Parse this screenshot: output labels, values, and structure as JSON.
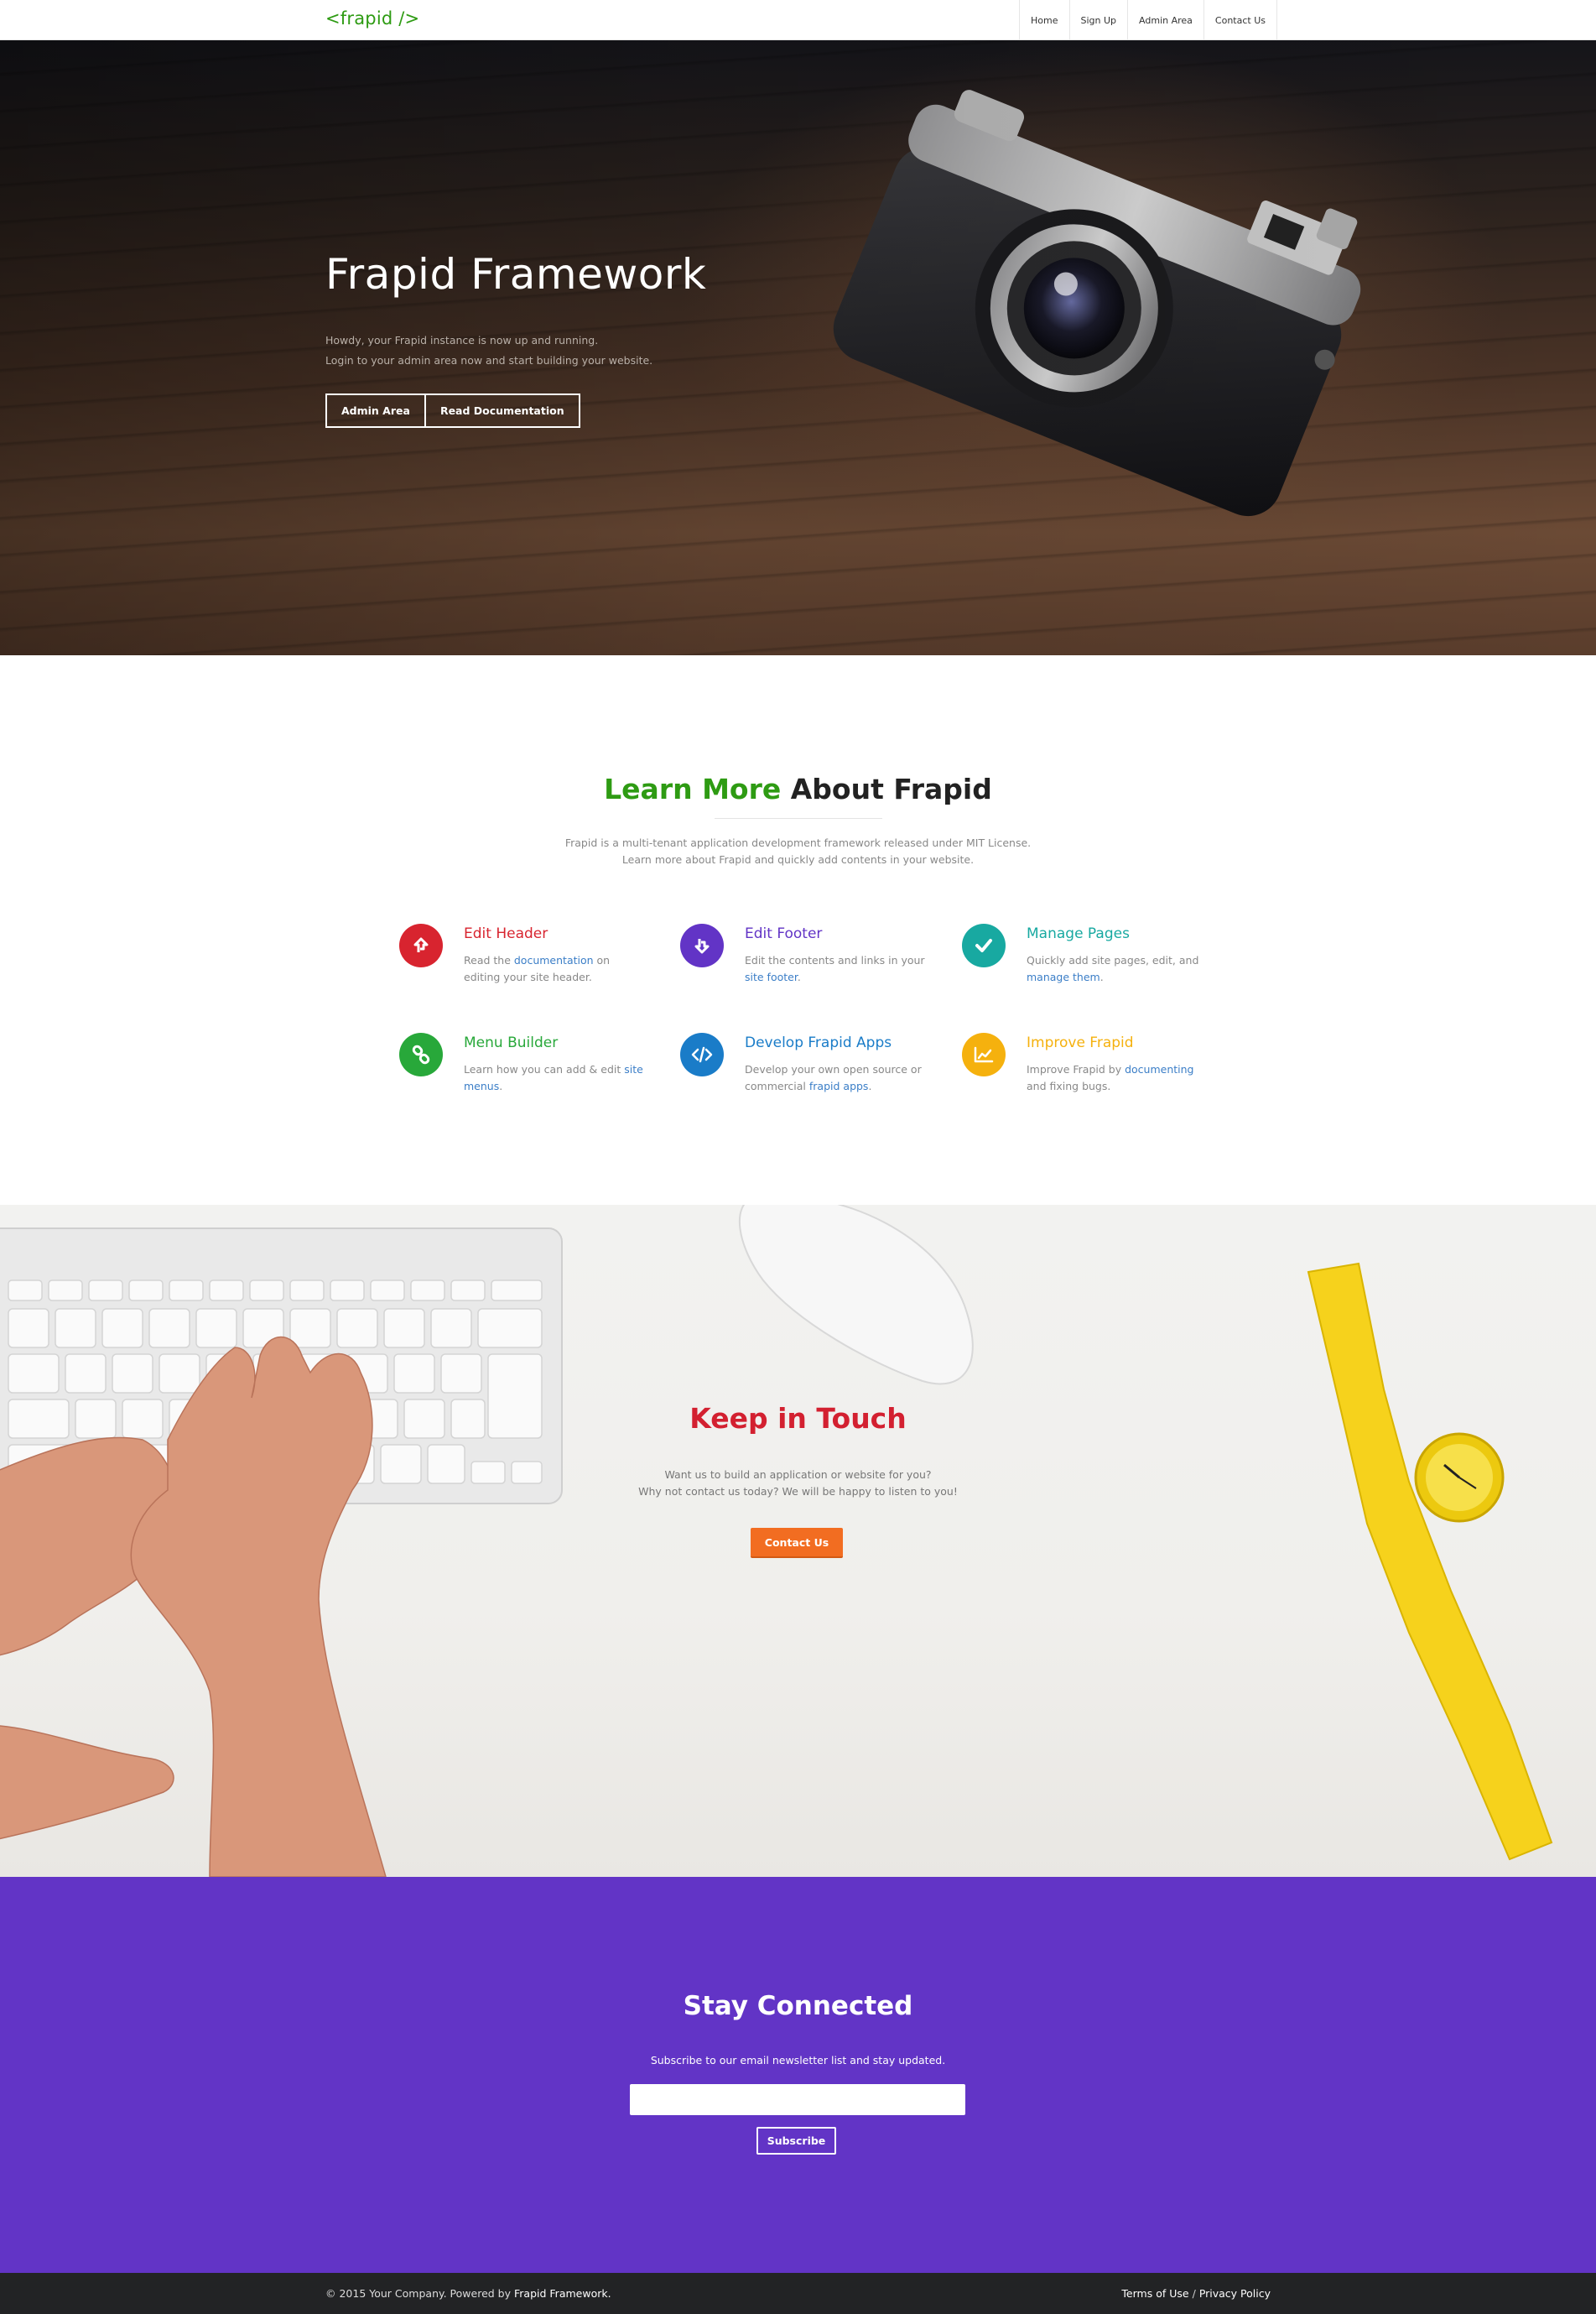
{
  "nav": {
    "logo": "<frapid />",
    "items": [
      {
        "label": "Home"
      },
      {
        "label": "Sign Up"
      },
      {
        "label": "Admin Area"
      },
      {
        "label": "Contact Us"
      }
    ]
  },
  "hero": {
    "title": "Frapid Framework",
    "line1": "Howdy, your Frapid instance is now up and running.",
    "line2": "Login to your admin area now and start building your website.",
    "btn_admin": "Admin Area",
    "btn_docs": "Read Documentation"
  },
  "learn": {
    "title_green": "Learn More",
    "title_rest": " About Frapid",
    "desc1": "Frapid is a multi-tenant application development framework released under MIT License.",
    "desc2": "Learn more about Frapid and quickly add contents in your website.",
    "features": [
      {
        "title": "Edit Header",
        "color": "#d8242f",
        "icon": "upload-arrow-icon",
        "pre": "Read the ",
        "link": "documentation",
        "post": " on editing your site header."
      },
      {
        "title": "Edit Footer",
        "color": "#6234c6",
        "icon": "download-arrow-icon",
        "pre": "Edit the contents and links in your ",
        "link": "site footer",
        "post": "."
      },
      {
        "title": "Manage Pages",
        "color": "#18a9a1",
        "icon": "check-icon",
        "pre": "Quickly add site pages, edit, and ",
        "link": "manage them",
        "post": "."
      },
      {
        "title": "Menu Builder",
        "color": "#28a83a",
        "icon": "link-icon",
        "pre": "Learn how you can add & edit ",
        "link": "site menus",
        "post": "."
      },
      {
        "title": "Develop Frapid Apps",
        "color": "#1a7cc8",
        "icon": "code-icon",
        "pre": "Develop your own open source or commercial ",
        "link": "frapid apps",
        "post": "."
      },
      {
        "title": "Improve Frapid",
        "color": "#f5b10e",
        "icon": "chart-line-icon",
        "pre": "Improve Frapid by ",
        "link": "documenting",
        "post": " and fixing bugs."
      }
    ]
  },
  "touch": {
    "title": "Keep in Touch",
    "line1": "Want us to build an application or website for you?",
    "line2": "Why not contact us today? We will be happy to listen to you!",
    "button": "Contact Us"
  },
  "stay": {
    "title": "Stay Connected",
    "desc": "Subscribe to our email newsletter list and stay updated.",
    "email_value": "",
    "button": "Subscribe"
  },
  "footer": {
    "copyright": "© 2015 Your Company. Powered by",
    "powered_link": "Frapid Framework.",
    "terms": "Terms of Use",
    "separator": "/",
    "privacy": "Privacy Policy"
  }
}
